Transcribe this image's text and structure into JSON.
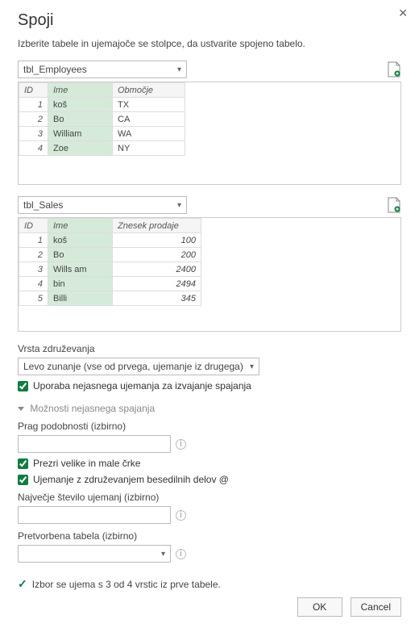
{
  "dialog": {
    "title": "Spoji",
    "subtitle": "Izberite tabele in ujemajoče se stolpce, da ustvarite spojeno tabelo."
  },
  "table1": {
    "selected": "tbl_Employees",
    "columns": [
      "ID",
      "Ime",
      "Območje"
    ],
    "selected_col": "Ime",
    "rows": [
      {
        "id": "1",
        "name": "koš",
        "region": "TX"
      },
      {
        "id": "2",
        "name": "Bo",
        "region": "CA"
      },
      {
        "id": "3",
        "name": "William",
        "region": "WA"
      },
      {
        "id": "4",
        "name": "Zoe",
        "region": "NY"
      }
    ]
  },
  "table2": {
    "selected": "tbl_Sales",
    "columns": [
      "ID",
      "Ime",
      "Znesek prodaje"
    ],
    "selected_col": "Ime",
    "rows": [
      {
        "id": "1",
        "name": "koš",
        "amount": "100"
      },
      {
        "id": "2",
        "name": "Bo",
        "amount": "200"
      },
      {
        "id": "3",
        "name": "Wills am",
        "amount": "2400"
      },
      {
        "id": "4",
        "name": "bin",
        "amount": "2494"
      },
      {
        "id": "5",
        "name": "Billi",
        "amount": "345"
      }
    ]
  },
  "join": {
    "label": "Vrsta združevanja",
    "selected": "Levo zunanje (vse od prvega, ujemanje iz drugega)"
  },
  "fuzzy": {
    "checkbox": "Uporaba nejasnega ujemanja za izvajanje spajanja",
    "header": "Možnosti nejasnega spajanja",
    "threshold_label": "Prag podobnosti (izbirno)",
    "ignore_case": "Prezri velike in male črke",
    "combine_parts": "Ujemanje z združevanjem besedilnih delov @",
    "max_matches_label": "Največje število ujemanj (izbirno)",
    "transform_label": "Pretvorbena tabela (izbirno)"
  },
  "status": "Izbor se ujema s 3 od 4 vrstic iz prve tabele.",
  "buttons": {
    "ok": "OK",
    "cancel": "Cancel"
  }
}
